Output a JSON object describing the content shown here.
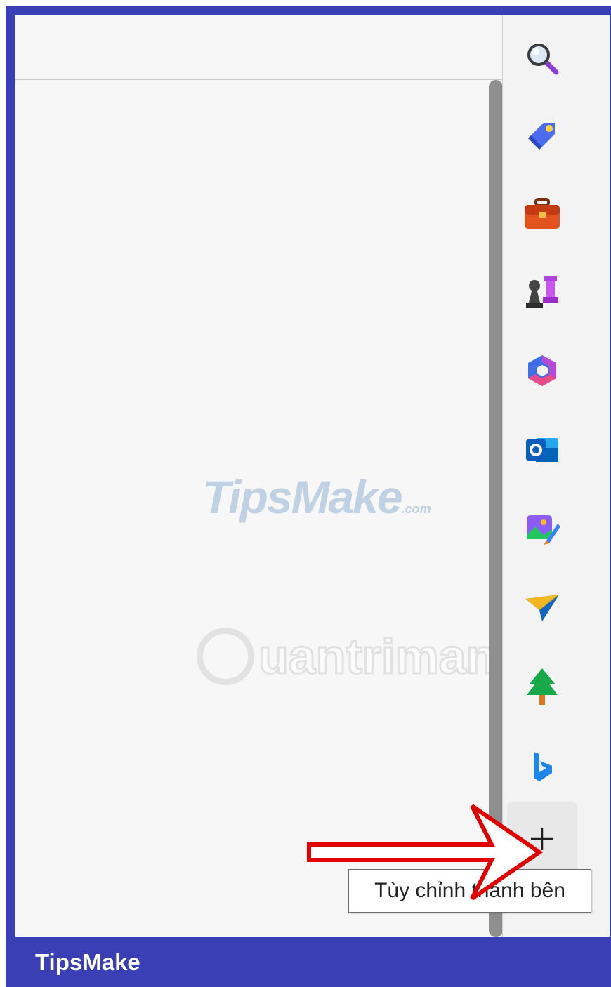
{
  "sidebar": {
    "items": [
      {
        "icon": "search-icon"
      },
      {
        "icon": "shopping-tag-icon"
      },
      {
        "icon": "tools-toolbox-icon"
      },
      {
        "icon": "games-chess-icon"
      },
      {
        "icon": "microsoft-365-icon"
      },
      {
        "icon": "outlook-icon"
      },
      {
        "icon": "image-creator-icon"
      },
      {
        "icon": "drop-send-icon"
      },
      {
        "icon": "tree-icon"
      },
      {
        "icon": "bing-icon"
      }
    ],
    "add_button": {
      "icon": "plus-icon"
    },
    "tooltip": "Tùy chỉnh thanh bên"
  },
  "watermark": {
    "tipsmake": "TipsMake",
    "tipsmake_domain": ".com",
    "quantrimang": "uantrimang"
  },
  "footer": {
    "brand": "TipsMake"
  },
  "colors": {
    "frame": "#3a3fb5",
    "annotation_arrow": "#e00000",
    "scroll_thumb": "#8f8f8f"
  }
}
